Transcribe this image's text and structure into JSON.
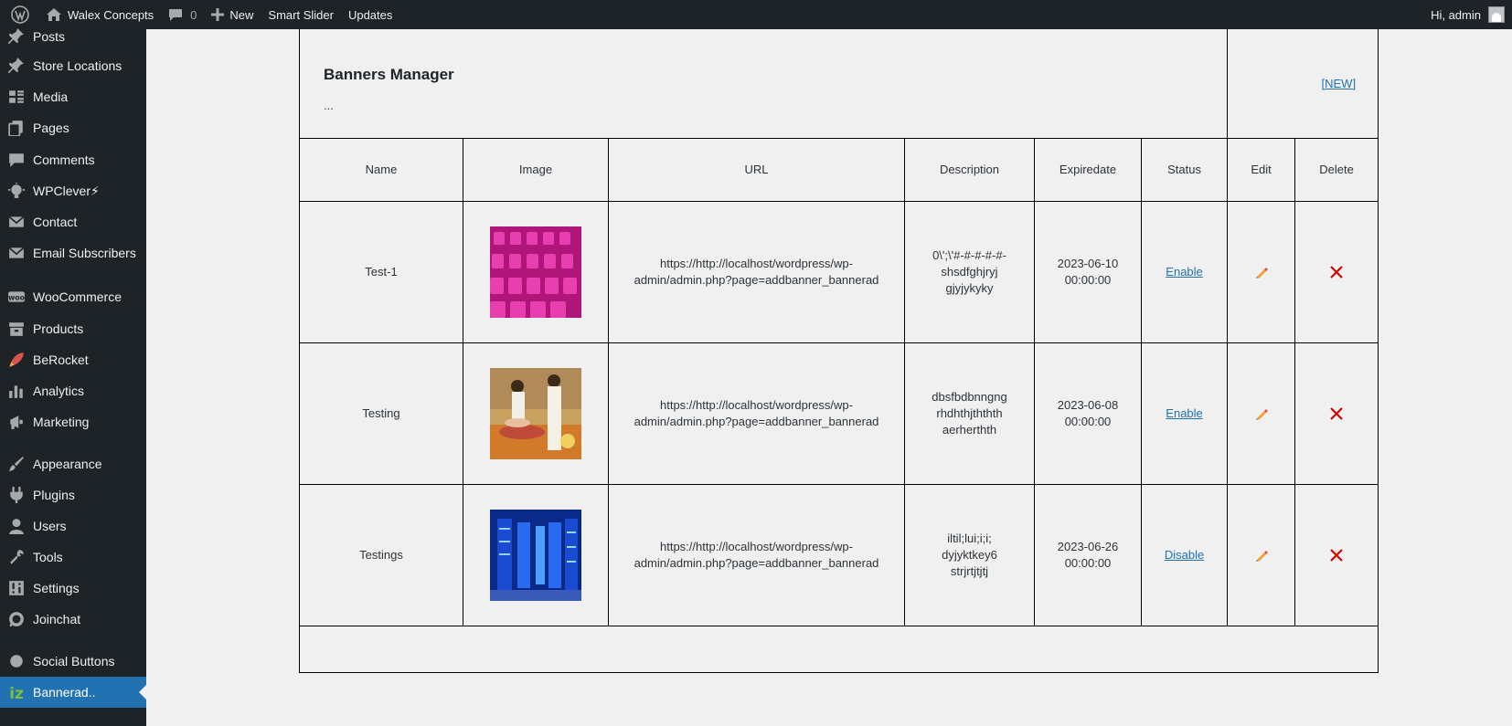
{
  "adminbar": {
    "site_name": "Walex Concepts",
    "comments_count": "0",
    "new_label": "New",
    "smart_slider_label": "Smart Slider",
    "updates_label": "Updates",
    "greeting": "Hi, admin"
  },
  "sidebar": {
    "items": [
      {
        "label": "Posts",
        "icon": "pushpin-icon"
      },
      {
        "label": "Store Locations",
        "icon": "pushpin-icon"
      },
      {
        "label": "Media",
        "icon": "media-icon"
      },
      {
        "label": "Pages",
        "icon": "pages-icon"
      },
      {
        "label": "Comments",
        "icon": "comment-icon"
      },
      {
        "label": "WPClever⚡",
        "icon": "lightbulb-icon"
      },
      {
        "label": "Contact",
        "icon": "mail-icon"
      },
      {
        "label": "Email Subscribers",
        "icon": "mail-icon"
      },
      {
        "label": "WooCommerce",
        "icon": "woo-icon"
      },
      {
        "label": "Products",
        "icon": "archive-icon"
      },
      {
        "label": "BeRocket",
        "icon": "rocket-icon"
      },
      {
        "label": "Analytics",
        "icon": "chart-icon"
      },
      {
        "label": "Marketing",
        "icon": "megaphone-icon"
      },
      {
        "label": "Appearance",
        "icon": "brush-icon"
      },
      {
        "label": "Plugins",
        "icon": "plugin-icon"
      },
      {
        "label": "Users",
        "icon": "user-icon"
      },
      {
        "label": "Tools",
        "icon": "wrench-icon"
      },
      {
        "label": "Settings",
        "icon": "settings-icon"
      },
      {
        "label": "Joinchat",
        "icon": "whatsapp-icon"
      },
      {
        "label": "Social Buttons",
        "icon": "share-icon"
      },
      {
        "label": "Bannerad..",
        "icon": "iz-icon"
      }
    ]
  },
  "main": {
    "title": "Banners Manager",
    "subtitle": "...",
    "new_link": "[NEW]",
    "columns": [
      "Name",
      "Image",
      "URL",
      "Description",
      "Expiredate",
      "Status",
      "Edit",
      "Delete"
    ],
    "rows": [
      {
        "name": "Test-1",
        "url_line1": "https://http://localhost/wordpress/wp-",
        "url_line2": "admin/admin.php?page=addbanner_bannerad",
        "desc_line1": "0\\';\\'#-#-#-#-#-",
        "desc_line2": "shsdfghjryj",
        "desc_line3": "gjyjykyky",
        "date_line1": "2023-06-10",
        "date_line2": "00:00:00",
        "status": "Enable"
      },
      {
        "name": "Testing",
        "url_line1": "https://http://localhost/wordpress/wp-",
        "url_line2": "admin/admin.php?page=addbanner_bannerad",
        "desc_line1": "dbsfbdbnngng",
        "desc_line2": "rhdhthjththth",
        "desc_line3": "aerherthth",
        "date_line1": "2023-06-08",
        "date_line2": "00:00:00",
        "status": "Enable"
      },
      {
        "name": "Testings",
        "url_line1": "https://http://localhost/wordpress/wp-",
        "url_line2": "admin/admin.php?page=addbanner_bannerad",
        "desc_line1": "iltil;lui;i;i;",
        "desc_line2": "dyjyktkey6",
        "desc_line3": "strjrtjtjtj",
        "date_line1": "2023-06-26",
        "date_line2": "00:00:00",
        "status": "Disable"
      }
    ]
  },
  "colors": {
    "adminbar_bg": "#1d2327",
    "sidebar_bg": "#1d2327",
    "current_menu_bg": "#2271b1",
    "link": "#2271b1",
    "delete_x": "#d00000"
  }
}
